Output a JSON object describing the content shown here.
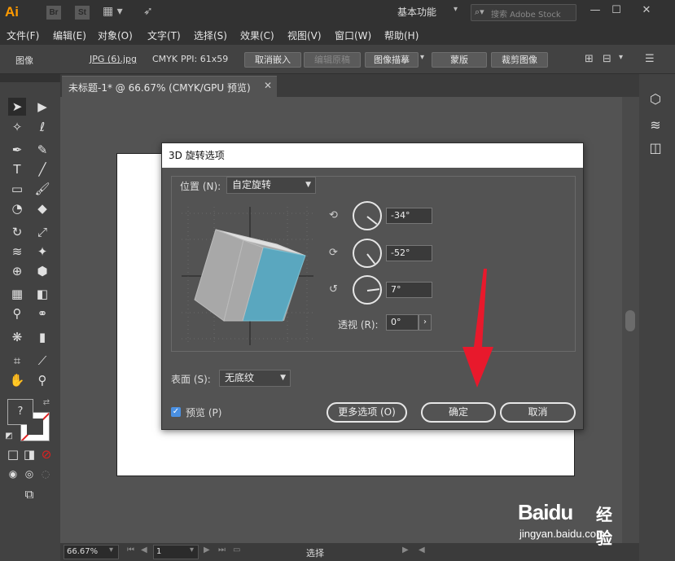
{
  "app": {
    "logo": "Ai",
    "bridge": "Br",
    "stock": "St",
    "workspace": "基本功能",
    "search_placeholder": "搜索 Adobe Stock"
  },
  "menu": [
    "文件(F)",
    "编辑(E)",
    "对象(O)",
    "文字(T)",
    "选择(S)",
    "效果(C)",
    "视图(V)",
    "窗口(W)",
    "帮助(H)"
  ],
  "control": {
    "label": "图像",
    "file": "JPG (6).jpg",
    "mode": "CMYK",
    "ppi": "PPI: 61x59",
    "unembed": "取消嵌入",
    "edit_original": "编辑原稿",
    "image_trace": "图像描摹",
    "mask": "蒙版",
    "crop": "裁剪图像"
  },
  "doc_tab": {
    "title": "未标题-1* @ 66.67% (CMYK/GPU 预览)"
  },
  "dialog": {
    "title": "3D 旋转选项",
    "position_label": "位置 (N):",
    "position_value": "自定旋转",
    "x_angle": "-34°",
    "y_angle": "-52°",
    "z_angle": "7°",
    "perspective_label": "透视 (R):",
    "perspective_value": "0°",
    "surface_label": "表面 (S):",
    "surface_value": "无底纹",
    "preview_label": "预览 (P)",
    "more_options": "更多选项 (O)",
    "ok": "确定",
    "cancel": "取消"
  },
  "status": {
    "zoom": "66.67%",
    "page": "1",
    "tool": "选择"
  },
  "watermark": {
    "brand": "Baidu",
    "brand_cn": "经验",
    "url": "jingyan.baidu.com"
  },
  "colors": {
    "accent_arrow": "#e8192c",
    "cube_side": "#5aa7bf",
    "logo": "#ff9a00"
  }
}
